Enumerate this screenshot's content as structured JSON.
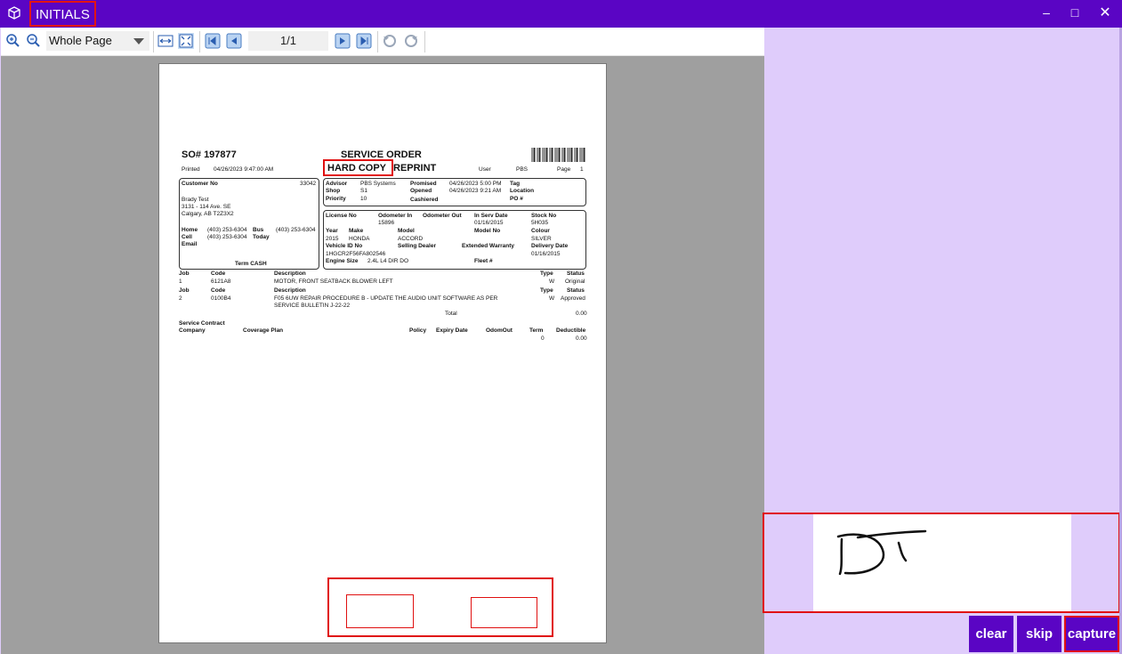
{
  "window": {
    "title": "INITIALS",
    "minimize_glyph": "–",
    "maximize_glyph": "□",
    "close_glyph": "✕"
  },
  "toolbar": {
    "zoom_value": "Whole Page",
    "page_indicator": "1/1"
  },
  "document": {
    "so_number": "SO# 197877",
    "heading": "SERVICE ORDER",
    "hard_copy": "HARD COPY",
    "reprint": "REPRINT",
    "printed_label": "Printed",
    "printed_value": "04/26/2023 9:47:00 AM",
    "user_label": "User",
    "user_value": "PBS",
    "page_label": "Page",
    "page_value": "1",
    "customer": {
      "no_label": "Customer No",
      "no_value": "33042",
      "name": "Brady Test",
      "address1": "3131 - 114 Ave. SE",
      "address2": "Calgary, AB T2Z3X2",
      "home_label": "Home",
      "home_value": "(403) 253-6304",
      "bus_label": "Bus",
      "bus_value": "(403) 253-6304",
      "cell_label": "Cell",
      "cell_value": "(403) 253-6304",
      "today_label": "Today",
      "email_label": "Email",
      "term": "Term CASH"
    },
    "advisor": {
      "advisor_label": "Advisor",
      "advisor_value": "PBS Systems",
      "shop_label": "Shop",
      "shop_value": "S1",
      "priority_label": "Priority",
      "priority_value": "10",
      "promised_label": "Promised",
      "promised_value": "04/26/2023 5:00 PM",
      "opened_label": "Opened",
      "opened_value": "04/26/2023 9:21 AM",
      "cashiered_label": "Cashiered",
      "tag_label": "Tag",
      "location_label": "Location",
      "po_label": "PO #"
    },
    "vehicle": {
      "license_label": "License No",
      "odo_in_label": "Odometer In",
      "odo_in_value": "15896",
      "odo_out_label": "Odometer Out",
      "inserv_label": "In Serv Date",
      "inserv_value": "01/16/2015",
      "stock_label": "Stock No",
      "stock_value": "5H035",
      "year_label": "Year",
      "year_value": "2015",
      "make_label": "Make",
      "make_value": "HONDA",
      "model_label": "Model",
      "model_value": "ACCORD",
      "modelno_label": "Model No",
      "colour_label": "Colour",
      "colour_value": "SILVER",
      "vin_label": "Vehicle ID No",
      "vin_value": "1HGCR2F56FA802546",
      "selling_label": "Selling Dealer",
      "warranty_label": "Extended Warranty",
      "delivery_label": "Delivery Date",
      "delivery_value": "01/16/2015",
      "engine_label": "Engine Size",
      "engine_value": "2.4L L4 DIR DO",
      "fleet_label": "Fleet #"
    },
    "jobs_header": {
      "job": "Job",
      "code": "Code",
      "description": "Description",
      "type": "Type",
      "status": "Status"
    },
    "jobs": [
      {
        "job": "1",
        "code": "6121A8",
        "description": "MOTOR, FRONT SEATBACK BLOWER LEFT",
        "description2": "",
        "type": "W",
        "status": "Original"
      },
      {
        "job": "2",
        "code": "0100B4",
        "description": "F05 6UW REPAIR PROCEDURE B - UPDATE THE AUDIO UNIT SOFTWARE AS PER",
        "description2": "SERVICE BULLETIN J-22-22",
        "type": "W",
        "status": "Approved"
      }
    ],
    "total_label": "Total",
    "total_value": "0.00",
    "contract": {
      "title": "Service Contract",
      "company": "Company",
      "coverage": "Coverage Plan",
      "policy": "Policy",
      "expiry": "Expiry Date",
      "odomout": "OdomOut",
      "term": "Term",
      "term_value": "0",
      "deductible": "Deductible",
      "deductible_value": "0.00"
    }
  },
  "signature": {
    "strokes_text": "DT"
  },
  "actions": {
    "clear": "clear",
    "skip": "skip",
    "capture": "capture"
  },
  "colors": {
    "titlebar": "#5a05c4",
    "panel": "#dfccfb",
    "highlight": "#e01010"
  }
}
